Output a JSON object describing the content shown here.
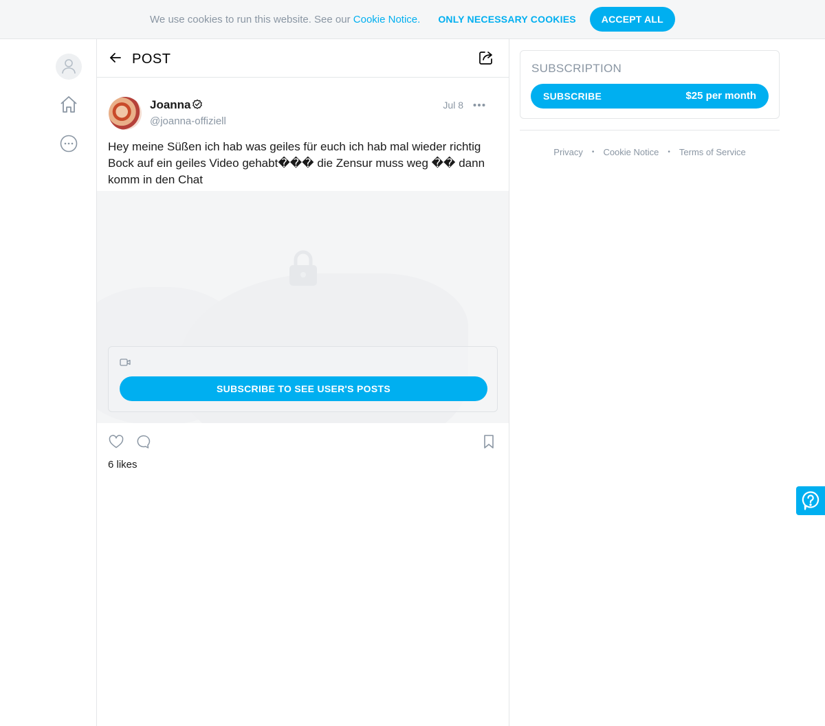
{
  "cookie_bar": {
    "text": "We use cookies to run this website. See our",
    "link_label": "Cookie Notice.",
    "necessary_label": "ONLY NECESSARY COOKIES",
    "accept_label": "ACCEPT ALL"
  },
  "nav": {
    "icons": [
      "user-icon",
      "home-icon",
      "more-icon"
    ]
  },
  "post": {
    "header_title": "POST",
    "author_name": "Joanna",
    "author_handle": "@joanna-offiziell",
    "date": "Jul 8",
    "text": "Hey meine Süßen ich hab was geiles für euch ich hab mal wieder richtig Bock auf ein geiles Video gehabt��� die Zensur muss weg �� dann komm in den Chat",
    "subscribe_posts_label": "SUBSCRIBE TO SEE USER'S POSTS",
    "likes": "6 likes"
  },
  "subscription": {
    "title": "SUBSCRIPTION",
    "button_label": "SUBSCRIBE",
    "price": "$25 per month"
  },
  "footer": {
    "privacy": "Privacy",
    "cookie_notice": "Cookie Notice",
    "terms": "Terms of Service"
  },
  "colors": {
    "accent": "#00aff0",
    "muted": "#8a96a3",
    "border": "#e4e6e8"
  }
}
